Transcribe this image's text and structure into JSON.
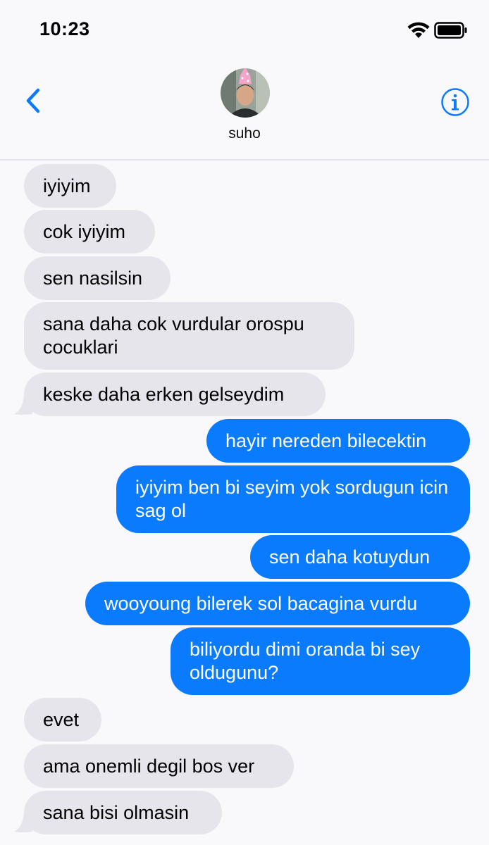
{
  "status_bar": {
    "time": "10:23"
  },
  "header": {
    "contact_name": "suho",
    "back_icon": "chevron-left-icon",
    "info_icon": "info-circle-icon"
  },
  "colors": {
    "sent_bubble": "#0b7bfe",
    "received_bubble": "#e7e5ec",
    "accent": "#0b7bfe",
    "background": "#f9f9fb"
  },
  "messages": [
    {
      "direction": "received",
      "text": "iyiyim"
    },
    {
      "direction": "received",
      "text": "cok iyiyim"
    },
    {
      "direction": "received",
      "text": "sen nasilsin"
    },
    {
      "direction": "received",
      "text": "sana daha cok vurdular orospu cocuklari"
    },
    {
      "direction": "received",
      "text": "keske daha erken gelseydim"
    },
    {
      "direction": "sent",
      "text": "hayir nereden bilecektin"
    },
    {
      "direction": "sent",
      "text": "iyiyim ben bi seyim yok sordugun icin sag ol"
    },
    {
      "direction": "sent",
      "text": "sen daha kotuydun"
    },
    {
      "direction": "sent",
      "text": "wooyoung bilerek sol bacagina vurdu"
    },
    {
      "direction": "sent",
      "text": "biliyordu dimi oranda bi sey oldugunu?"
    },
    {
      "direction": "received",
      "text": "evet"
    },
    {
      "direction": "received",
      "text": "ama onemli degil bos ver"
    },
    {
      "direction": "received",
      "text": "sana bisi olmasin"
    }
  ]
}
